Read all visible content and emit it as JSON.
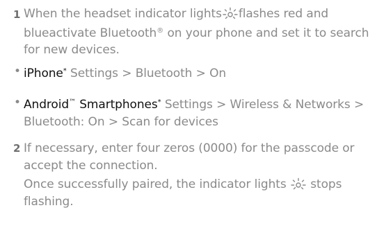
{
  "step1": {
    "number": "1",
    "text_a": "When the headset indicator lights",
    "text_b": "flashes red and blueactivate Bluetooth",
    "registered": "®",
    "text_c": "on your phone and set it to search for new devices."
  },
  "bullets": [
    {
      "bullet": "•",
      "brand": "iPhone",
      "brand_mark": "*",
      "text": "Settings > Bluetooth > On"
    },
    {
      "bullet": "•",
      "brand": "Android",
      "trademark": "™",
      "brand_suffix": " Smartphones",
      "brand_mark": "*",
      "text": "Settings > Wireless & Networks > Bluetooth: On > Scan for devices"
    }
  ],
  "step2": {
    "number": "2",
    "text": "If necessary, enter four zeros (0000) for the passcode or accept the connection.",
    "followup_a": "Once successfully paired, the indicator lights",
    "followup_b": "stops flashing."
  },
  "icons": {
    "indicator": "indicator-light-icon"
  },
  "colors": {
    "body_text": "#8a8a8a",
    "brand_text": "#111111",
    "step_number": "#6f6f6f"
  }
}
